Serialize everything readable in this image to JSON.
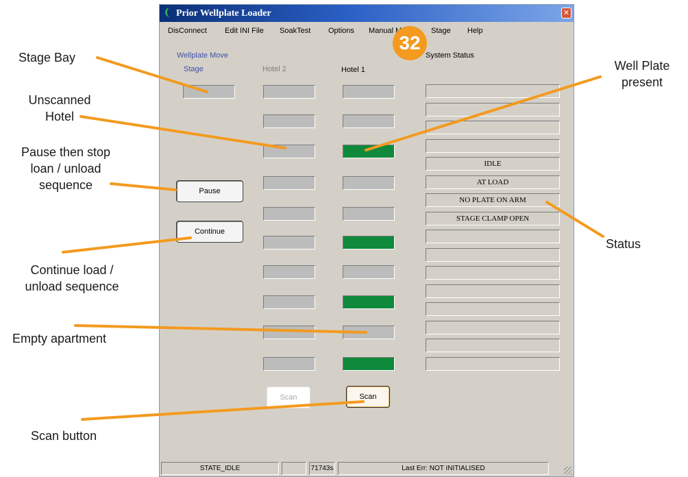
{
  "window": {
    "title": "Prior Wellplate Loader"
  },
  "menu": [
    "DisConnect",
    "Edit INI File",
    "SoakTest",
    "Options",
    "Manual Move",
    "Stage",
    "Help"
  ],
  "badge": "32",
  "panel": {
    "group_label": "Wellplate Move",
    "stage_label": "Stage",
    "hotel2_label": "Hotel 2",
    "hotel1_label": "Hotel 1",
    "system_status_label": "System Status"
  },
  "hotel1_present": [
    false,
    false,
    true,
    false,
    false,
    true,
    false,
    true,
    false,
    true
  ],
  "system_status": [
    "",
    "",
    "",
    "",
    "IDLE",
    "AT LOAD",
    "NO PLATE ON ARM",
    "STAGE CLAMP OPEN",
    "",
    "",
    "",
    "",
    "",
    "",
    "",
    ""
  ],
  "buttons": {
    "pause": "Pause",
    "continue": "Continue",
    "scan_hotel2": "Scan",
    "scan_hotel1": "Scan"
  },
  "statusbar": {
    "state": "STATE_IDLE",
    "blank": "",
    "time": "71743s",
    "error": "Last Err: NOT INITIALISED"
  },
  "callouts": {
    "stage_bay": "Stage Bay",
    "unscanned_line1": "Unscanned",
    "unscanned_line2": "Hotel",
    "pause_line1": "Pause then stop",
    "pause_line2": "loan / unload",
    "pause_line3": "sequence",
    "continue_line1": "Continue load /",
    "continue_line2": "unload sequence",
    "empty": "Empty apartment",
    "scan": "Scan button",
    "well_line1": "Well Plate",
    "well_line2": "present",
    "status": "Status"
  },
  "colors": {
    "accent_orange": "#f39a1f",
    "plate_green": "#0f8a3c",
    "empty_grey": "#bcbcbc",
    "window_bg": "#d4d0c8"
  }
}
